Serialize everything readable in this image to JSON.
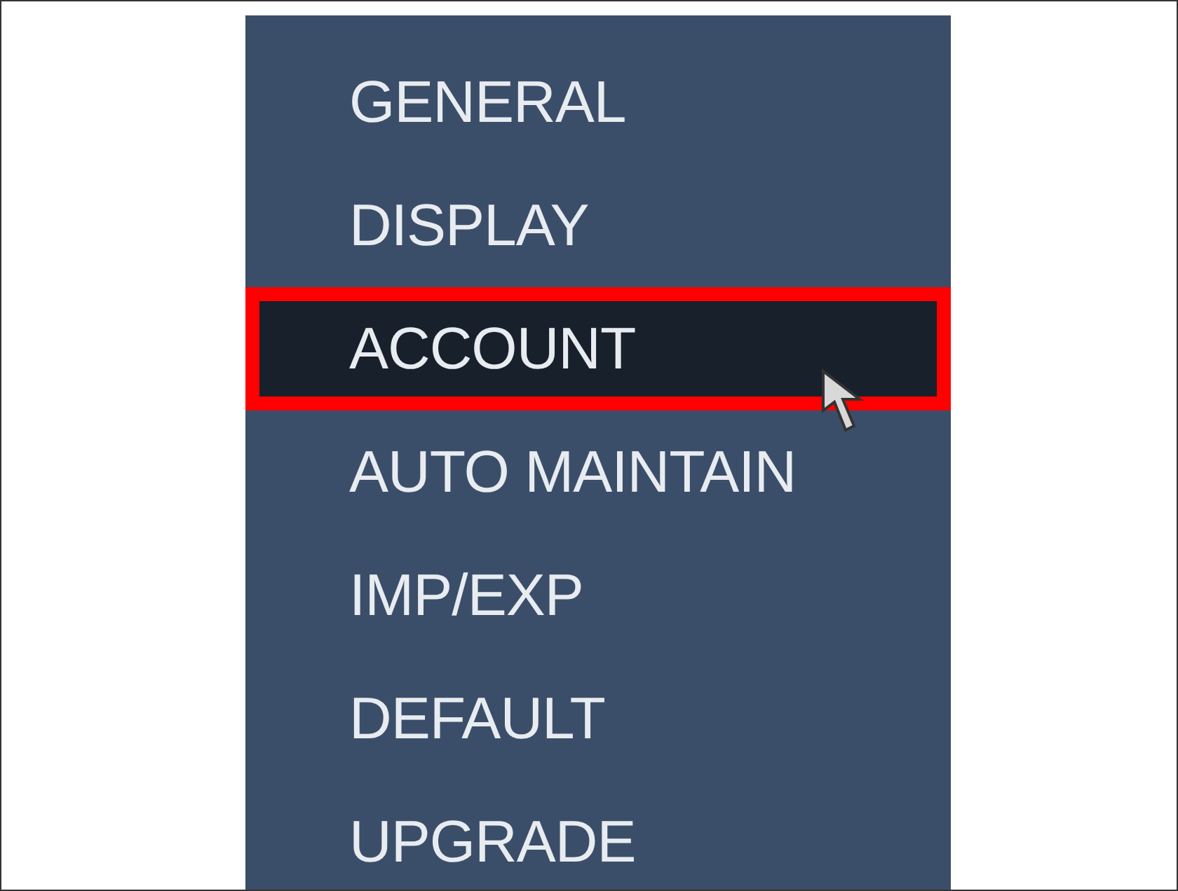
{
  "menu": {
    "items": [
      {
        "label": "GENERAL",
        "selected": false
      },
      {
        "label": "DISPLAY",
        "selected": false
      },
      {
        "label": "ACCOUNT",
        "selected": true
      },
      {
        "label": "AUTO MAINTAIN",
        "selected": false
      },
      {
        "label": "IMP/EXP",
        "selected": false
      },
      {
        "label": "DEFAULT",
        "selected": false
      },
      {
        "label": "UPGRADE",
        "selected": false
      }
    ]
  }
}
